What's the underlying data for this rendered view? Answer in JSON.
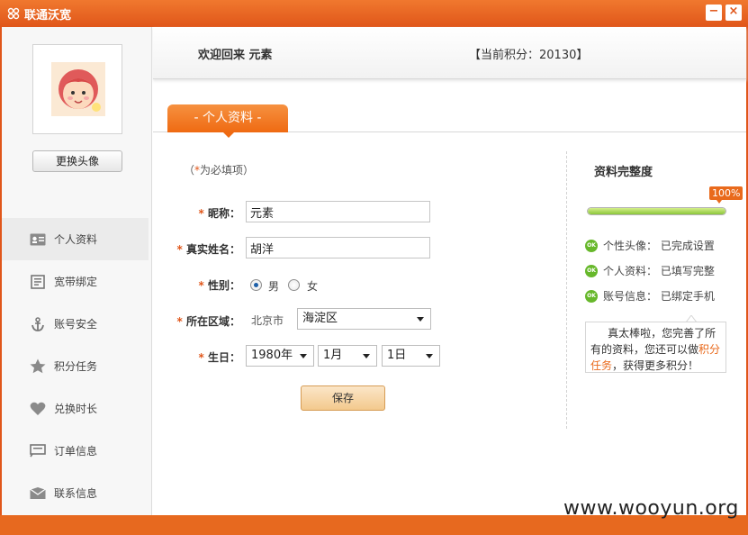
{
  "window": {
    "title": "联通沃宽",
    "minimize": "−",
    "close": "×"
  },
  "colors": {
    "accent": "#ef6a12",
    "titlebar": "#e0561a",
    "ok_green": "#67b82b",
    "progress": "#8bc63a"
  },
  "sidebar": {
    "change_avatar_label": "更换头像",
    "items": [
      {
        "label": "个人资料",
        "icon": "id-card-icon",
        "active": true
      },
      {
        "label": "宽带绑定",
        "icon": "document-icon"
      },
      {
        "label": "账号安全",
        "icon": "anchor-icon"
      },
      {
        "label": "积分任务",
        "icon": "star-icon"
      },
      {
        "label": "兑换时长",
        "icon": "heart-icon"
      },
      {
        "label": "订单信息",
        "icon": "order-icon"
      },
      {
        "label": "联系信息",
        "icon": "mail-icon"
      }
    ]
  },
  "header": {
    "welcome": "欢迎回来 元素",
    "points": "【当前积分：20130】"
  },
  "tab": {
    "label": "- 个人资料 -"
  },
  "form": {
    "required_note_open": "（",
    "required_note_star": "*",
    "required_note_text": "为必填项）",
    "nickname_label": "昵称：",
    "nickname_value": "元素",
    "realname_label": "真实姓名：",
    "realname_value": "胡洋",
    "gender_label": "性别：",
    "gender_male": "男",
    "gender_female": "女",
    "gender_selected": "男",
    "region_label": "所在区域：",
    "city": "北京市",
    "district": "海淀区",
    "birthday_label": "生日：",
    "birth_year": "1980年",
    "birth_month": "1月",
    "birth_day": "1日",
    "save_label": "保存"
  },
  "completion": {
    "title": "资料完整度",
    "percent_label": "100%",
    "percent": 100,
    "items": [
      {
        "label": "个性头像：",
        "status": "已完成设置"
      },
      {
        "label": "个人资料：",
        "status": "已填写完整"
      },
      {
        "label": "账号信息：",
        "status": "已绑定手机"
      }
    ],
    "ok_label": "OK",
    "tip_part1": "真太棒啦，您完善了所有的资料，您还可以做",
    "tip_link": "积分任务",
    "tip_part2": "，获得更多积分！"
  },
  "watermark": "www.wooyun.org"
}
